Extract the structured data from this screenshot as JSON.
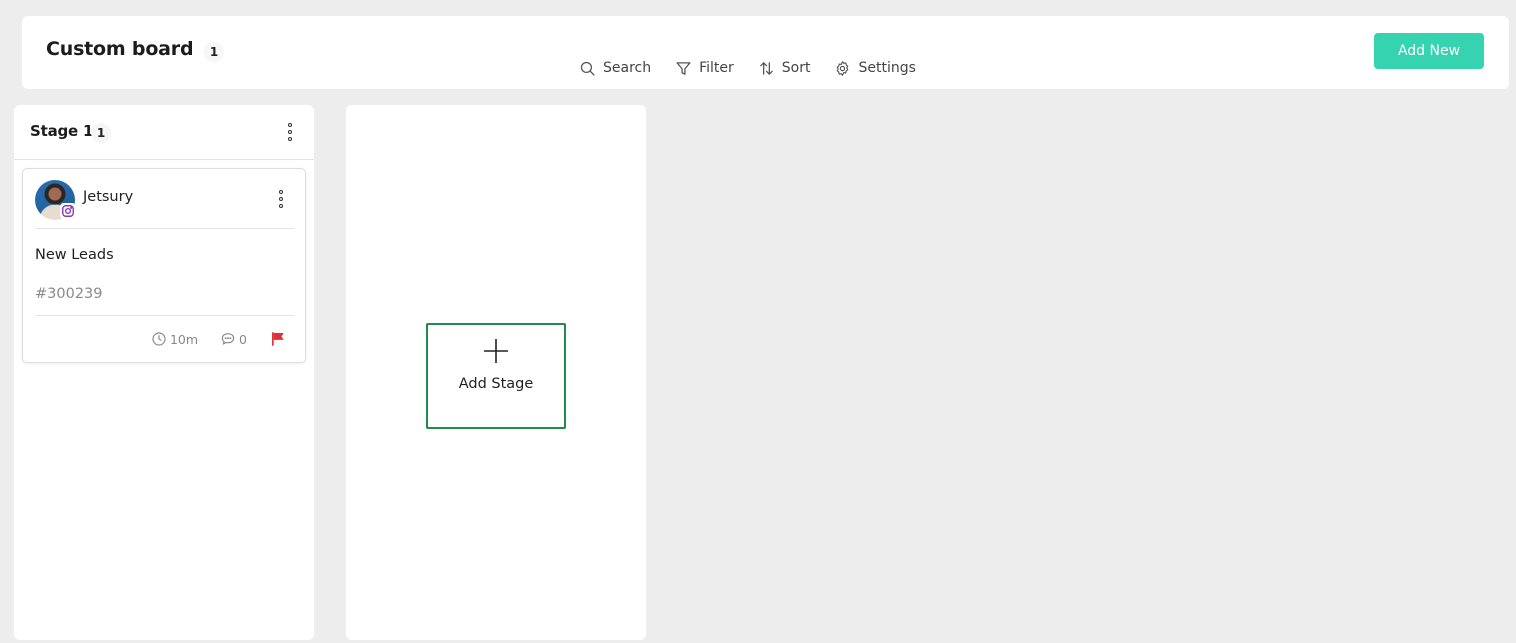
{
  "header": {
    "title": "Custom board",
    "count": "1",
    "add_new_label": "Add New"
  },
  "toolbar": {
    "items": [
      {
        "label": "Search",
        "icon": "search-icon"
      },
      {
        "label": "Filter",
        "icon": "filter-icon"
      },
      {
        "label": "Sort",
        "icon": "sort-icon"
      },
      {
        "label": "Settings",
        "icon": "gear-icon"
      }
    ]
  },
  "stages": [
    {
      "title": "Stage 1",
      "count": "1",
      "cards": [
        {
          "name": "Jetsury",
          "source_icon": "instagram-icon",
          "stage_name": "New Leads",
          "id": "#300239",
          "time": "10m",
          "comments": "0",
          "flag_color": "#e0313b"
        }
      ]
    }
  ],
  "add_stage": {
    "label": "Add Stage"
  },
  "colors": {
    "accent": "#35d3b0",
    "add_stage_border": "#1f8a4c",
    "flag": "#e0313b",
    "background": "#ededed"
  }
}
